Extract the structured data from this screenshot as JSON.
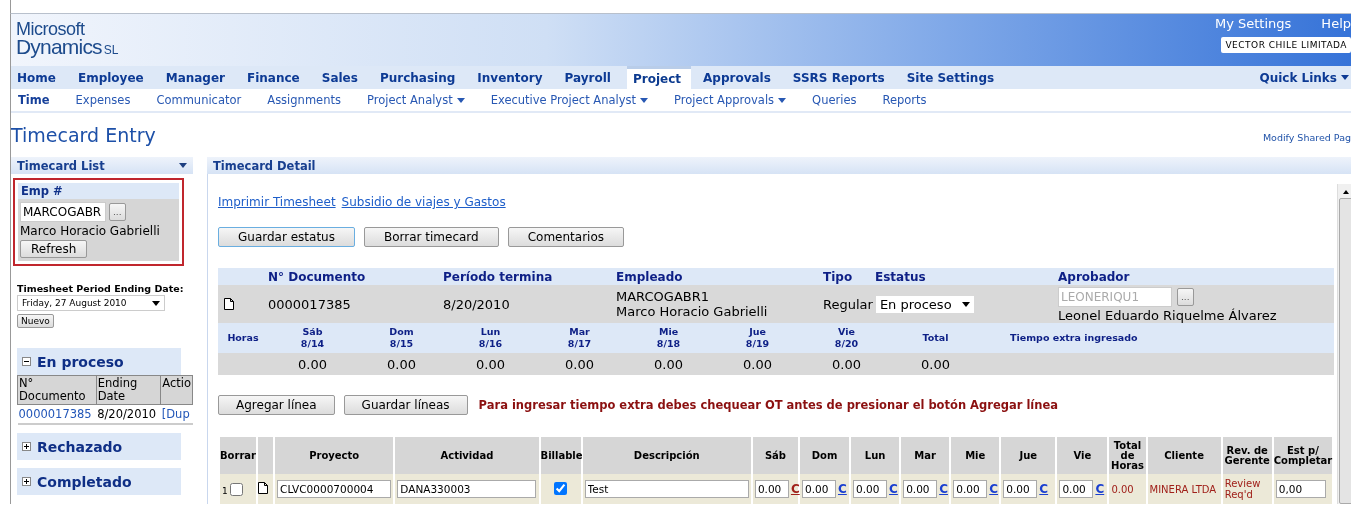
{
  "header": {
    "logo_line1": "Microsoft",
    "logo_line2": "Dynamics",
    "logo_suffix": "SL",
    "links": [
      "My Settings",
      "Help"
    ],
    "company": "VECTOR CHILE LIMITADA"
  },
  "main_nav": [
    {
      "label": "Home",
      "selected": false
    },
    {
      "label": "Employee",
      "selected": false
    },
    {
      "label": "Manager",
      "selected": false
    },
    {
      "label": "Finance",
      "selected": false
    },
    {
      "label": "Sales",
      "selected": false
    },
    {
      "label": "Purchasing",
      "selected": false
    },
    {
      "label": "Inventory",
      "selected": false
    },
    {
      "label": "Payroll",
      "selected": false
    },
    {
      "label": "Project",
      "selected": true
    },
    {
      "label": "Approvals",
      "selected": false
    },
    {
      "label": "SSRS Reports",
      "selected": false
    },
    {
      "label": "Site Settings",
      "selected": false
    }
  ],
  "quick_links": "Quick Links",
  "sub_nav": [
    {
      "label": "Time",
      "selected": true,
      "dropdown": false
    },
    {
      "label": "Expenses",
      "selected": false,
      "dropdown": false
    },
    {
      "label": "Communicator",
      "selected": false,
      "dropdown": false
    },
    {
      "label": "Assignments",
      "selected": false,
      "dropdown": false
    },
    {
      "label": "Project Analyst",
      "selected": false,
      "dropdown": true
    },
    {
      "label": "Executive Project Analyst",
      "selected": false,
      "dropdown": true
    },
    {
      "label": "Project Approvals",
      "selected": false,
      "dropdown": true
    },
    {
      "label": "Queries",
      "selected": false,
      "dropdown": false
    },
    {
      "label": "Reports",
      "selected": false,
      "dropdown": false
    }
  ],
  "page_title": "Timecard Entry",
  "modify_link": "Modify Shared Pag",
  "timecard_list": {
    "title": "Timecard List",
    "emp_label": "Emp #",
    "emp_value": "MARCOGABR",
    "lookup": "...",
    "emp_name": "Marco Horacio Gabrielli",
    "refresh": "Refresh",
    "period_label": "Timesheet Period Ending Date:",
    "period_value": "Friday, 27 August 2010",
    "nuevo": "Nuevo",
    "sections": [
      {
        "title": "En proceso",
        "expanded": true,
        "columns": [
          "N° Documento",
          "Ending Date",
          "Actio"
        ],
        "rows": [
          [
            "0000017385",
            "8/20/2010",
            "[Dup"
          ]
        ]
      },
      {
        "title": "Rechazado",
        "expanded": false
      },
      {
        "title": "Completado",
        "expanded": false
      }
    ]
  },
  "detail": {
    "title": "Timecard Detail",
    "links": [
      "Imprimir Timesheet",
      "Subsidio de viajes y Gastos"
    ],
    "buttons": [
      "Guardar estatus",
      "Borrar timecard",
      "Comentarios"
    ],
    "summary": {
      "columns": [
        "N° Documento",
        "Período termina",
        "Empleado",
        "Tipo",
        "Estatus",
        "Aprobador"
      ],
      "document": "0000017385",
      "period": "8/20/2010",
      "employee_id": "MARCOGABR1",
      "employee_name": "Marco Horacio Gabrielli",
      "tipo": "Regular",
      "estatus": "En proceso",
      "approver_id": "LEONERIQU1",
      "approver_disabled": true,
      "lookup": "...",
      "approver_name": "Leonel Eduardo Riquelme Álvarez"
    },
    "hours": {
      "label": "Horas",
      "days": [
        {
          "day": "Sáb",
          "date": "8/14",
          "value": "0.00"
        },
        {
          "day": "Dom",
          "date": "8/15",
          "value": "0.00"
        },
        {
          "day": "Lun",
          "date": "8/16",
          "value": "0.00"
        },
        {
          "day": "Mar",
          "date": "8/17",
          "value": "0.00"
        },
        {
          "day": "Mie",
          "date": "8/18",
          "value": "0.00"
        },
        {
          "day": "Jue",
          "date": "8/19",
          "value": "0.00"
        },
        {
          "day": "Vie",
          "date": "8/20",
          "value": "0.00"
        }
      ],
      "total_label": "Total",
      "total": "0.00",
      "overtime_label": "Tiempo extra ingresado"
    },
    "line_buttons": [
      "Agregar línea",
      "Guardar líneas"
    ],
    "warning": "Para ingresar tiempo extra debes chequear OT antes de presionar el botón Agregar línea",
    "lines": {
      "columns": [
        "Borrar",
        "Proyecto",
        "Actividad",
        "Billable",
        "Descripción",
        "Sáb",
        "Dom",
        "Lun",
        "Mar",
        "Mie",
        "Jue",
        "Vie",
        "Total de Horas",
        "Cliente",
        "Rev. de Gerente",
        "Est p/ Completar"
      ],
      "rows": [
        {
          "number": "1",
          "delete": false,
          "project": "CLVC0000700004",
          "activity": "DANA330003",
          "billable": true,
          "description": "Test",
          "hours": [
            {
              "value": "0.00",
              "link": "C",
              "visited": true
            },
            {
              "value": "0.00",
              "link": "C",
              "visited": false
            },
            {
              "value": "0.00",
              "link": "C",
              "visited": false
            },
            {
              "value": "0.00",
              "link": "C",
              "visited": false
            },
            {
              "value": "0.00",
              "link": "C",
              "visited": false
            },
            {
              "value": "0.00",
              "link": "C",
              "visited": false
            },
            {
              "value": "0.00",
              "link": "C",
              "visited": false
            }
          ],
          "total": "0.00",
          "client": "MINERA LTDA",
          "review": "Review Req'd",
          "estimate": "0,00"
        }
      ]
    }
  }
}
